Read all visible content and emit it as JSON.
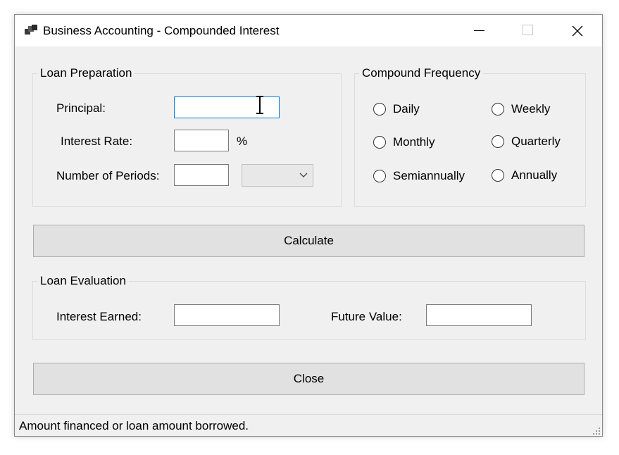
{
  "window": {
    "title": "Business Accounting - Compounded Interest"
  },
  "loan_preparation": {
    "legend": "Loan Preparation",
    "principal_label": "Principal:",
    "principal_value": "",
    "interest_rate_label": "Interest Rate:",
    "interest_rate_value": "",
    "percent_sign": "%",
    "periods_label": "Number of Periods:",
    "periods_value": "",
    "period_unit_selected": ""
  },
  "compound_frequency": {
    "legend": "Compound Frequency",
    "options": [
      "Daily",
      "Weekly",
      "Monthly",
      "Quarterly",
      "Semiannually",
      "Annually"
    ]
  },
  "buttons": {
    "calculate": "Calculate",
    "close": "Close"
  },
  "loan_evaluation": {
    "legend": "Loan Evaluation",
    "interest_earned_label": "Interest Earned:",
    "interest_earned_value": "",
    "future_value_label": "Future Value:",
    "future_value_value": ""
  },
  "status_bar": {
    "text": "Amount financed or loan amount borrowed."
  },
  "icons": {
    "app": "app-window-icon",
    "minimize": "minimize-icon",
    "maximize": "maximize-icon",
    "close": "close-icon",
    "combo_arrow": "chevron-down-icon",
    "cursor": "text-cursor-icon",
    "grip": "resize-grip-icon"
  },
  "colors": {
    "focus_border": "#0078d7",
    "button_face": "#e1e1e1",
    "form_background": "#f0f0f0"
  }
}
